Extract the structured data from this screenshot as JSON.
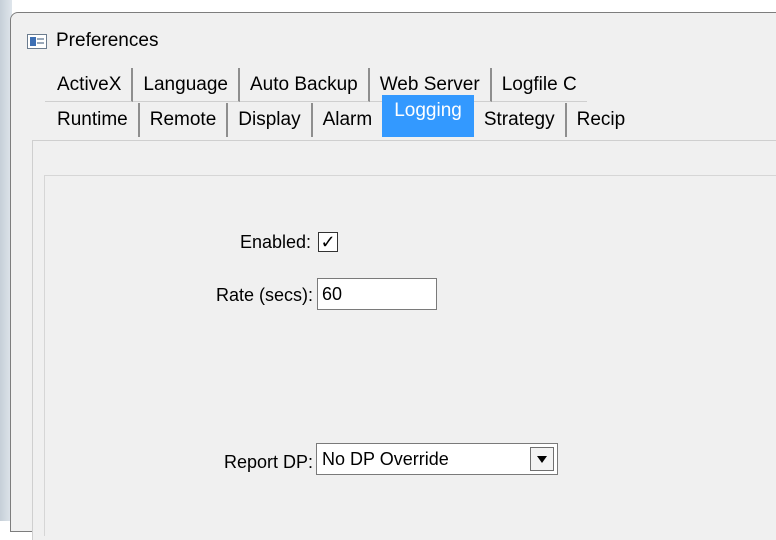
{
  "window": {
    "title": "Preferences"
  },
  "tabs_back": [
    "ActiveX",
    "Language",
    "Auto Backup",
    "Web Server",
    "Logfile C"
  ],
  "tabs_front": [
    "Runtime",
    "Remote",
    "Display",
    "Alarm",
    "Logging",
    "Strategy",
    "Recip"
  ],
  "selected_tab": "Logging",
  "form": {
    "enabled_label": "Enabled:",
    "enabled_checked": true,
    "enabled_mark": "✓",
    "rate_label": "Rate (secs):",
    "rate_value": "60",
    "report_dp_label": "Report DP:",
    "report_dp_value": "No DP Override"
  },
  "colors": {
    "accent": "#3399ff"
  }
}
